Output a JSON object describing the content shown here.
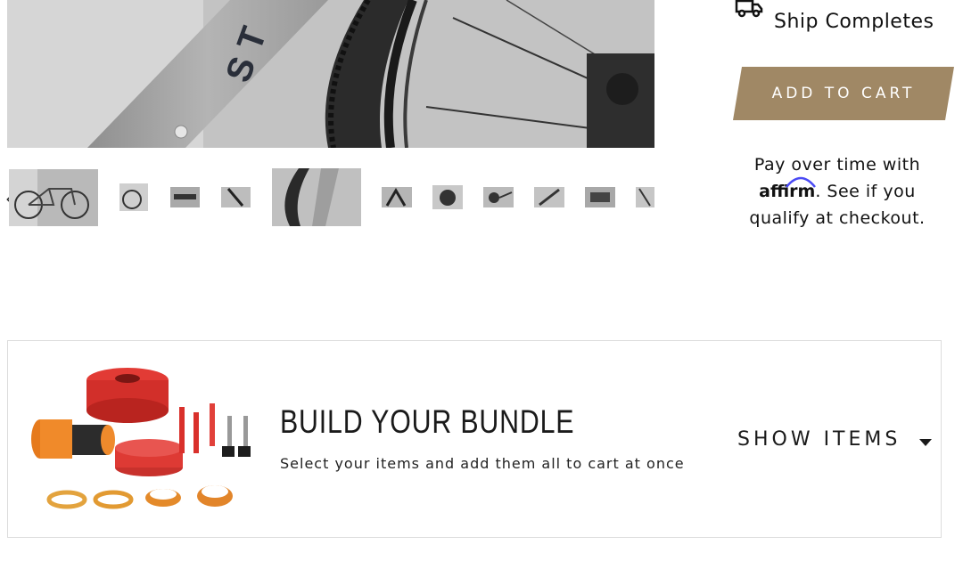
{
  "shipping": {
    "icon": "truck-icon",
    "text": "Ship Completes"
  },
  "cart": {
    "button_label": "ADD TO CART",
    "button_color": "#a08865"
  },
  "affirm": {
    "line1": "Pay over time with",
    "logo_text": "affirm",
    "after_logo": ". See if you",
    "line3": "qualify at checkout.",
    "accent_color": "#4a4af4"
  },
  "gallery": {
    "prev_label": "‹",
    "prev_icon": "chevron-left-icon"
  },
  "bundle": {
    "title": "BUILD YOUR BUNDLE",
    "subtitle": "Select your items and add them all to cart at once",
    "toggle_label": "SHOW ITEMS",
    "toggle_icon": "caret-down-icon"
  }
}
